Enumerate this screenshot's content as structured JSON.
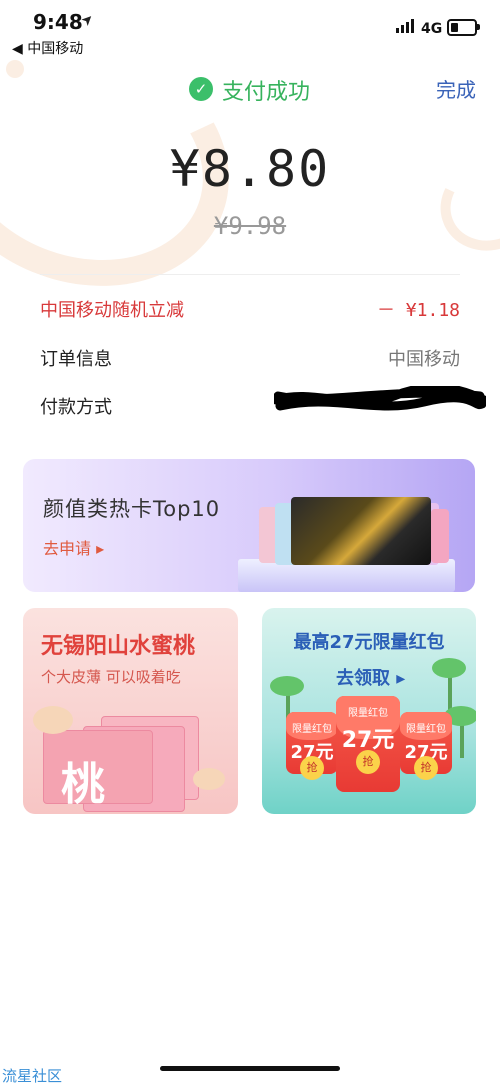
{
  "status_bar": {
    "time": "9:48",
    "location_arrow": "➤",
    "back_carrier": "◀ 中国移动",
    "network": "4G"
  },
  "header": {
    "title": "支付成功",
    "done_label": "完成",
    "check_icon": "✓"
  },
  "amount": {
    "paid": "¥8.80",
    "original": "¥9.98"
  },
  "details": {
    "discount_label": "中国移动随机立减",
    "discount_value": "－ ¥1.18",
    "order_label": "订单信息",
    "order_value": "中国移动",
    "payment_label": "付款方式"
  },
  "banner": {
    "title": "颜值类热卡Top10",
    "link": "去申请 ▸"
  },
  "promo_left": {
    "title": "无锡阳山水蜜桃",
    "subtitle": "个大皮薄 可以吸着吃",
    "peach_char": "桃"
  },
  "promo_right": {
    "title": "最高27元限量红包",
    "link": "去领取 ▸",
    "envelope_label": "限量红包",
    "envelope_amount": "27元",
    "seal_text": "抢"
  },
  "watermark": "流星社区",
  "colors": {
    "success_green": "#37b35d",
    "link_blue": "#3a63b8",
    "discount_red": "#d8393a"
  }
}
